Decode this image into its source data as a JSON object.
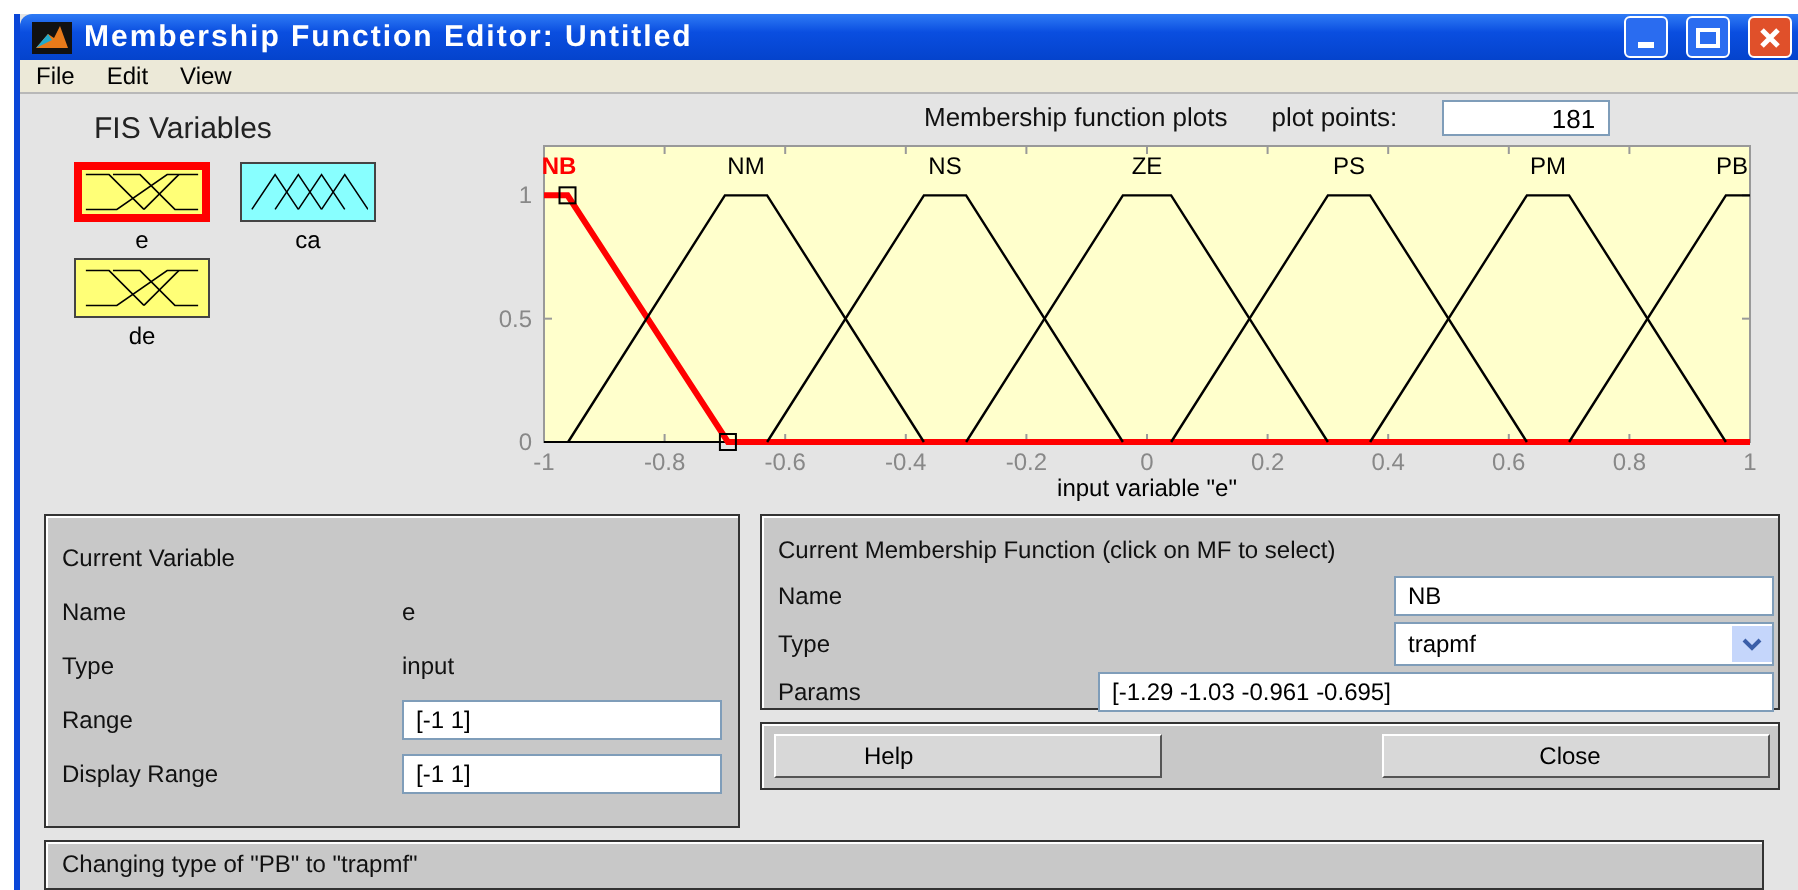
{
  "window": {
    "title": "Membership Function Editor: Untitled"
  },
  "menu": [
    "File",
    "Edit",
    "View"
  ],
  "fis_variables": {
    "title": "FIS Variables",
    "items": [
      {
        "name": "e",
        "kind": "input",
        "selected": true
      },
      {
        "name": "ca",
        "kind": "output",
        "selected": false
      },
      {
        "name": "de",
        "kind": "input",
        "selected": false
      }
    ]
  },
  "plot": {
    "title": "Membership function plots",
    "plot_points_label": "plot points:",
    "plot_points": "181",
    "curves": [
      {
        "selected": true
      },
      {
        "selected": false
      },
      {
        "selected": false
      },
      {
        "selected": false
      },
      {
        "selected": false
      },
      {
        "selected": false
      },
      {
        "selected": false
      }
    ],
    "chart_data": {
      "type": "line",
      "xlabel": "input variable \"e\"",
      "xlim": [
        -1,
        1
      ],
      "ylim": [
        0,
        1.2
      ],
      "xticks": [
        -1,
        -0.8,
        -0.6,
        -0.4,
        -0.2,
        0,
        0.2,
        0.4,
        0.6,
        0.8,
        1
      ],
      "yticks": [
        0,
        0.5,
        1
      ],
      "series": [
        {
          "name": "NB",
          "color": "#ff0000",
          "x": [
            -1,
            -0.961,
            -0.695,
            1
          ],
          "values": [
            1,
            1,
            0,
            0
          ]
        },
        {
          "name": "NM",
          "color": "#000000",
          "x": [
            -0.96,
            -0.7,
            -0.63,
            -0.37
          ],
          "values": [
            0,
            1,
            1,
            0
          ]
        },
        {
          "name": "NS",
          "color": "#000000",
          "x": [
            -0.63,
            -0.37,
            -0.3,
            -0.04
          ],
          "values": [
            0,
            1,
            1,
            0
          ]
        },
        {
          "name": "ZE",
          "color": "#000000",
          "x": [
            -0.3,
            -0.04,
            0.04,
            0.3
          ],
          "values": [
            0,
            1,
            1,
            0
          ]
        },
        {
          "name": "PS",
          "color": "#000000",
          "x": [
            0.04,
            0.3,
            0.37,
            0.63
          ],
          "values": [
            0,
            1,
            1,
            0
          ]
        },
        {
          "name": "PM",
          "color": "#000000",
          "x": [
            0.37,
            0.63,
            0.7,
            0.96
          ],
          "values": [
            0,
            1,
            1,
            0
          ]
        },
        {
          "name": "PB",
          "color": "#000000",
          "x": [
            0.7,
            0.96,
            1
          ],
          "values": [
            0,
            1,
            1
          ]
        }
      ]
    }
  },
  "current_variable": {
    "title": "Current Variable",
    "name_label": "Name",
    "name": "e",
    "type_label": "Type",
    "type": "input",
    "range_label": "Range",
    "range": "[-1 1]",
    "display_range_label": "Display Range",
    "display_range": "[-1 1]"
  },
  "current_mf": {
    "title": "Current Membership Function (click on MF to select)",
    "name_label": "Name",
    "name": "NB",
    "type_label": "Type",
    "type": "trapmf",
    "params_label": "Params",
    "params": "[-1.29 -1.03 -0.961 -0.695]"
  },
  "buttons": [
    "Help",
    "Close"
  ],
  "status": "Changing type of \"PB\" to \"trapmf\""
}
